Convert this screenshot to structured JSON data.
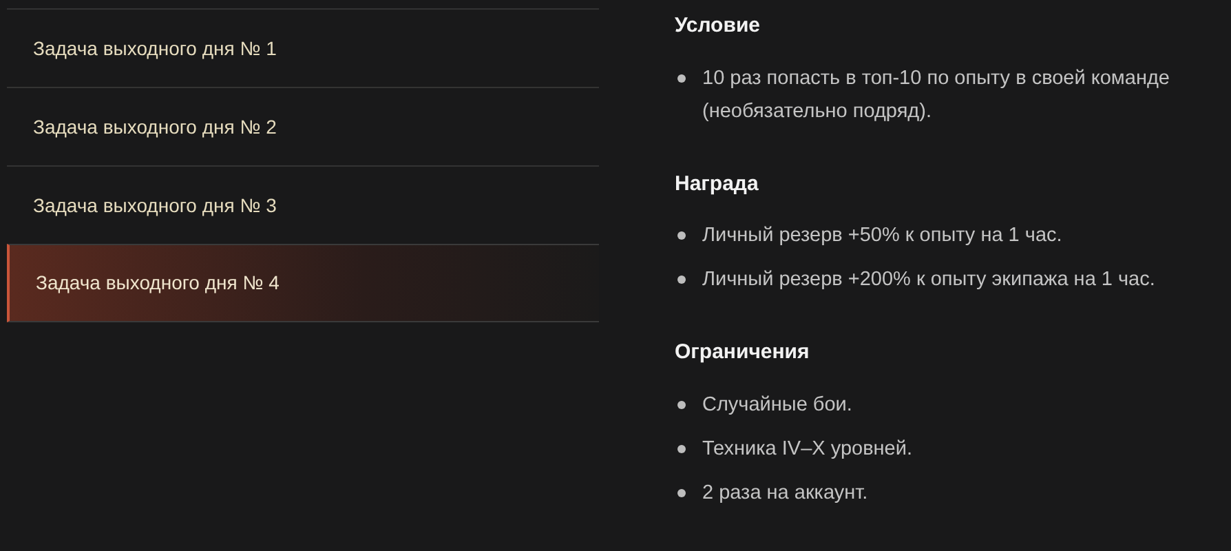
{
  "tasks": [
    {
      "label": "Задача выходного дня № 1",
      "selected": false
    },
    {
      "label": "Задача выходного дня № 2",
      "selected": false
    },
    {
      "label": "Задача выходного дня № 3",
      "selected": false
    },
    {
      "label": "Задача выходного дня № 4",
      "selected": true
    }
  ],
  "sections": [
    {
      "heading": "Условие",
      "items": [
        "10 раз попасть в топ-10 по опыту в своей команде (необязательно подряд)."
      ]
    },
    {
      "heading": "Награда",
      "items": [
        "Личный резерв +50% к опыту на 1 час.",
        "Личный резерв +200% к опыту экипажа на 1 час."
      ]
    },
    {
      "heading": "Ограничения",
      "items": [
        "Случайные бои.",
        "Техника IV–X уровней.",
        "2 раза на аккаунт."
      ]
    }
  ]
}
